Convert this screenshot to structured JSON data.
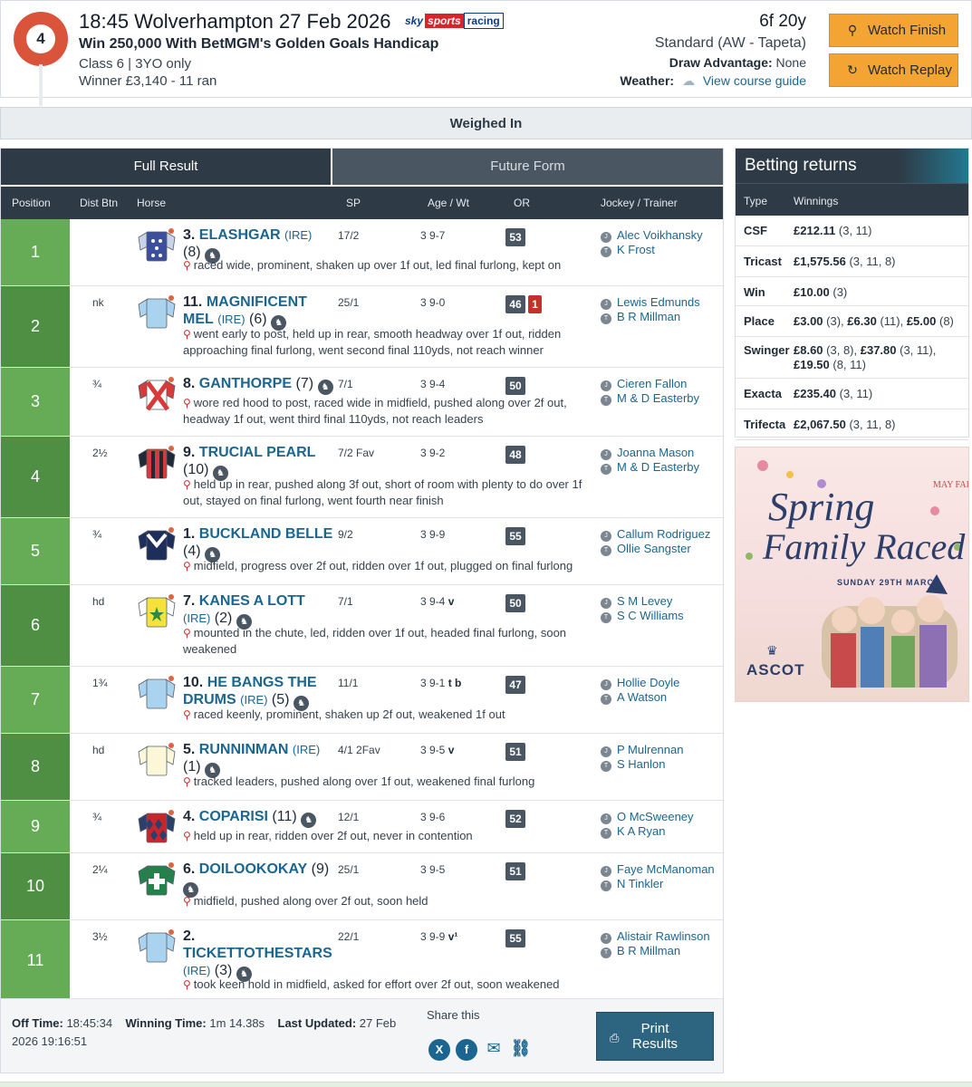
{
  "race": {
    "number": "4",
    "title": "18:45 Wolverhampton 27 Feb 2026",
    "sponsor_logo": {
      "sky": "sky",
      "sports": "sports",
      "racing": "racing"
    },
    "name": "Win 250,000 With BetMGM's Golden Goals Handicap",
    "class_line": "Class 6 | 3YO only",
    "winner_line": "Winner £3,140 - 11 ran",
    "distance": "6f 20y",
    "going": "Standard (AW - Tapeta)",
    "draw_label": "Draw Advantage:",
    "draw_value": "None",
    "weather_label": "Weather:",
    "course_guide_link": "View course guide",
    "watch_finish": "Watch Finish",
    "watch_replay": "Watch Replay"
  },
  "status": "Weighed In",
  "tabs": {
    "full_result": "Full Result",
    "future_form": "Future Form"
  },
  "columns": {
    "position": "Position",
    "dist_btn": "Dist Btn",
    "horse": "Horse",
    "sp": "SP",
    "age_wt": "Age / Wt",
    "or": "OR",
    "jockey_trainer": "Jockey / Trainer"
  },
  "runners": [
    {
      "pos": "1",
      "btn": "",
      "num": "3.",
      "name": "ELASHGAR",
      "country": "(IRE)",
      "draw": "(8)",
      "sp": "17/2",
      "age_wt": "3 9-7",
      "headgear": "",
      "or": "53",
      "or_extra": "",
      "jockey": "Alec Voikhansky",
      "trainer": "K Frost",
      "comment": "raced wide, prominent, shaken up over 1f out, led final furlong, kept on"
    },
    {
      "pos": "2",
      "btn": "nk",
      "num": "11.",
      "name": "MAGNIFICENT MEL",
      "country": "(IRE)",
      "draw": "(6)",
      "sp": "25/1",
      "age_wt": "3 9-0",
      "headgear": "",
      "or": "46",
      "or_extra": "1",
      "jockey": "Lewis Edmunds",
      "trainer": "B R Millman",
      "comment": "went early to post, held up in rear, smooth headway over 1f out, ridden approaching final furlong, went second final 110yds, not reach winner"
    },
    {
      "pos": "3",
      "btn": "¾",
      "num": "8.",
      "name": "GANTHORPE",
      "country": "",
      "draw": "(7)",
      "sp": "7/1",
      "age_wt": "3 9-4",
      "headgear": "",
      "or": "50",
      "or_extra": "",
      "jockey": "Cieren Fallon",
      "trainer": "M & D Easterby",
      "comment": "wore red hood to post, raced wide in midfield, pushed along over 2f out, headway 1f out, went third final 110yds, not reach leaders"
    },
    {
      "pos": "4",
      "btn": "2½",
      "num": "9.",
      "name": "TRUCIAL PEARL",
      "country": "",
      "draw": "(10)",
      "sp": "7/2 Fav",
      "age_wt": "3 9-2",
      "headgear": "",
      "or": "48",
      "or_extra": "",
      "jockey": "Joanna Mason",
      "trainer": "M & D Easterby",
      "comment": "held up in rear, pushed along 3f out, short of room with plenty to do over 1f out, stayed on final furlong, went fourth near finish"
    },
    {
      "pos": "5",
      "btn": "¾",
      "num": "1.",
      "name": "BUCKLAND BELLE",
      "country": "",
      "draw": "(4)",
      "sp": "9/2",
      "age_wt": "3 9-9",
      "headgear": "",
      "or": "55",
      "or_extra": "",
      "jockey": "Callum Rodriguez",
      "trainer": "Ollie Sangster",
      "comment": "midfield, progress over 2f out, ridden over 1f out, plugged on final furlong"
    },
    {
      "pos": "6",
      "btn": "hd",
      "num": "7.",
      "name": "KANES A LOTT",
      "country": "(IRE)",
      "draw": "(2)",
      "sp": "7/1",
      "age_wt": "3 9-4",
      "headgear": "v",
      "or": "50",
      "or_extra": "",
      "jockey": "S M Levey",
      "trainer": "S C Williams",
      "comment": "mounted in the chute, led, ridden over 1f out, headed final furlong, soon weakened"
    },
    {
      "pos": "7",
      "btn": "1¾",
      "num": "10.",
      "name": "HE BANGS THE DRUMS",
      "country": "(IRE)",
      "draw": "(5)",
      "sp": "11/1",
      "age_wt": "3 9-1",
      "headgear": "t b",
      "or": "47",
      "or_extra": "",
      "jockey": "Hollie Doyle",
      "trainer": "A Watson",
      "comment": "raced keenly, prominent, shaken up 2f out, weakened 1f out"
    },
    {
      "pos": "8",
      "btn": "hd",
      "num": "5.",
      "name": "RUNNINMAN",
      "country": "(IRE)",
      "draw": "(1)",
      "sp": "4/1 2Fav",
      "age_wt": "3 9-5",
      "headgear": "v",
      "or": "51",
      "or_extra": "",
      "jockey": "P Mulrennan",
      "trainer": "S Hanlon",
      "comment": "tracked leaders, pushed along over 1f out, weakened final furlong"
    },
    {
      "pos": "9",
      "btn": "¾",
      "num": "4.",
      "name": "COPARISI",
      "country": "",
      "draw": "(11)",
      "sp": "12/1",
      "age_wt": "3 9-6",
      "headgear": "",
      "or": "52",
      "or_extra": "",
      "jockey": "O McSweeney",
      "trainer": "K A Ryan",
      "comment": "held up in rear, ridden over 2f out, never in contention"
    },
    {
      "pos": "10",
      "btn": "2¼",
      "num": "6.",
      "name": "DOILOOKOKAY",
      "country": "",
      "draw": "(9)",
      "sp": "25/1",
      "age_wt": "3 9-5",
      "headgear": "",
      "or": "51",
      "or_extra": "",
      "jockey": "Faye McManoman",
      "trainer": "N Tinkler",
      "comment": "midfield, pushed along over 2f out, soon held"
    },
    {
      "pos": "11",
      "btn": "3½",
      "num": "2.",
      "name": "TICKETTOTHESTARS",
      "country": "(IRE)",
      "draw": "(3)",
      "sp": "22/1",
      "age_wt": "3 9-9",
      "headgear": "v¹",
      "or": "55",
      "or_extra": "",
      "jockey": "Alistair Rawlinson",
      "trainer": "B R Millman",
      "comment": "took keen hold in midfield, asked for effort over 2f out, soon weakened"
    }
  ],
  "jockey_badge": "J",
  "trainer_badge": "T",
  "footer": {
    "off_time_label": "Off Time:",
    "off_time": "18:45:34",
    "winning_time_label": "Winning Time:",
    "winning_time": "1m 14.38s",
    "last_updated_label": "Last Updated:",
    "last_updated": "27 Feb 2026 19:16:51",
    "share_label": "Share this",
    "share_icons": [
      "x-icon",
      "facebook-icon",
      "email-icon",
      "link-icon"
    ],
    "print_label_1": "Print",
    "print_label_2": "Results"
  },
  "betting": {
    "title": "Betting returns",
    "col_type": "Type",
    "col_winnings": "Winnings",
    "rows": [
      {
        "type": "CSF",
        "parts": [
          [
            "£212.11",
            " (3, 11)"
          ]
        ]
      },
      {
        "type": "Tricast",
        "parts": [
          [
            "£1,575.56",
            " (3, 11, 8)"
          ]
        ]
      },
      {
        "type": "Win",
        "parts": [
          [
            "£10.00",
            " (3)"
          ]
        ]
      },
      {
        "type": "Place",
        "parts": [
          [
            "£3.00",
            " (3), "
          ],
          [
            "£6.30",
            " (11), "
          ],
          [
            "£5.00",
            " (8)"
          ]
        ]
      },
      {
        "type": "Swinger",
        "parts": [
          [
            "£8.60",
            " (3, 8), "
          ],
          [
            "£37.80",
            " (3, 11), "
          ],
          [
            "£19.50",
            " (8, 11)"
          ]
        ]
      },
      {
        "type": "Exacta",
        "parts": [
          [
            "£235.40",
            " (3, 11)"
          ]
        ]
      },
      {
        "type": "Trifecta",
        "parts": [
          [
            "£2,067.50",
            " (3, 11, 8)"
          ]
        ]
      }
    ]
  },
  "ad": {
    "line1": "Spring",
    "line2": "Family Raced",
    "date": "SUNDAY 29TH MARCH",
    "corner": "MAY FAIR",
    "brand": "ASCOT"
  },
  "colors": {
    "pos_odd": "#66ac57",
    "pos_even": "#4f8f43",
    "header_dark": "#2e3a46",
    "link": "#1a6691",
    "watch_button": "#f3a433",
    "race_badge": "#d9543a"
  }
}
